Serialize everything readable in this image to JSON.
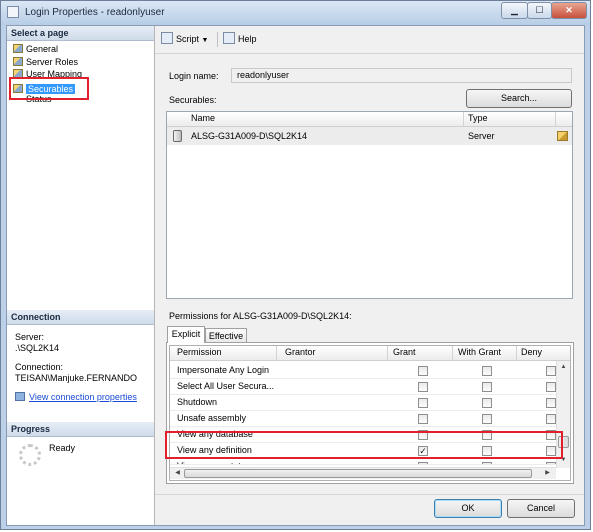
{
  "window": {
    "title": "Login Properties - readonlyuser"
  },
  "left": {
    "select_page_header": "Select a page",
    "pages": [
      {
        "label": "General"
      },
      {
        "label": "Server Roles"
      },
      {
        "label": "User Mapping"
      },
      {
        "label": "Securables"
      },
      {
        "label": "Status"
      }
    ],
    "connection_header": "Connection",
    "server_label": "Server:",
    "server_value": ".\\SQL2K14",
    "connection_label": "Connection:",
    "connection_value": "TEISAN\\Manjuke.FERNANDO",
    "view_connection_link": "View connection properties",
    "progress_header": "Progress",
    "progress_status": "Ready"
  },
  "toolbar": {
    "script_label": "Script",
    "help_label": "Help"
  },
  "login": {
    "login_name_label": "Login name:",
    "login_name_value": "readonlyuser",
    "securables_label": "Securables:",
    "search_button": "Search..."
  },
  "securables_grid": {
    "columns": [
      "Name",
      "Type"
    ],
    "rows": [
      {
        "name": "ALSG-G31A009-D\\SQL2K14",
        "type": "Server"
      }
    ]
  },
  "permissions": {
    "label": "Permissions for ALSG-G31A009-D\\SQL2K14:",
    "tabs": [
      "Explicit",
      "Effective"
    ],
    "columns": [
      "Permission",
      "Grantor",
      "Grant",
      "With Grant",
      "Deny"
    ],
    "rows": [
      {
        "permission": "Impersonate Any Login",
        "grant": false,
        "with_grant": false,
        "deny": false
      },
      {
        "permission": "Select All User Secura...",
        "grant": false,
        "with_grant": false,
        "deny": false
      },
      {
        "permission": "Shutdown",
        "grant": false,
        "with_grant": false,
        "deny": false
      },
      {
        "permission": "Unsafe assembly",
        "grant": false,
        "with_grant": false,
        "deny": false
      },
      {
        "permission": "View any database",
        "grant": false,
        "with_grant": false,
        "deny": false
      },
      {
        "permission": "View any definition",
        "grant": true,
        "with_grant": false,
        "deny": false
      },
      {
        "permission": "View server state",
        "grant": false,
        "with_grant": false,
        "deny": false
      }
    ]
  },
  "buttons": {
    "ok": "OK",
    "cancel": "Cancel"
  },
  "colors": {
    "highlight_box": "#e0202a",
    "selection": "#3399ff",
    "link": "#1a4bd6"
  }
}
